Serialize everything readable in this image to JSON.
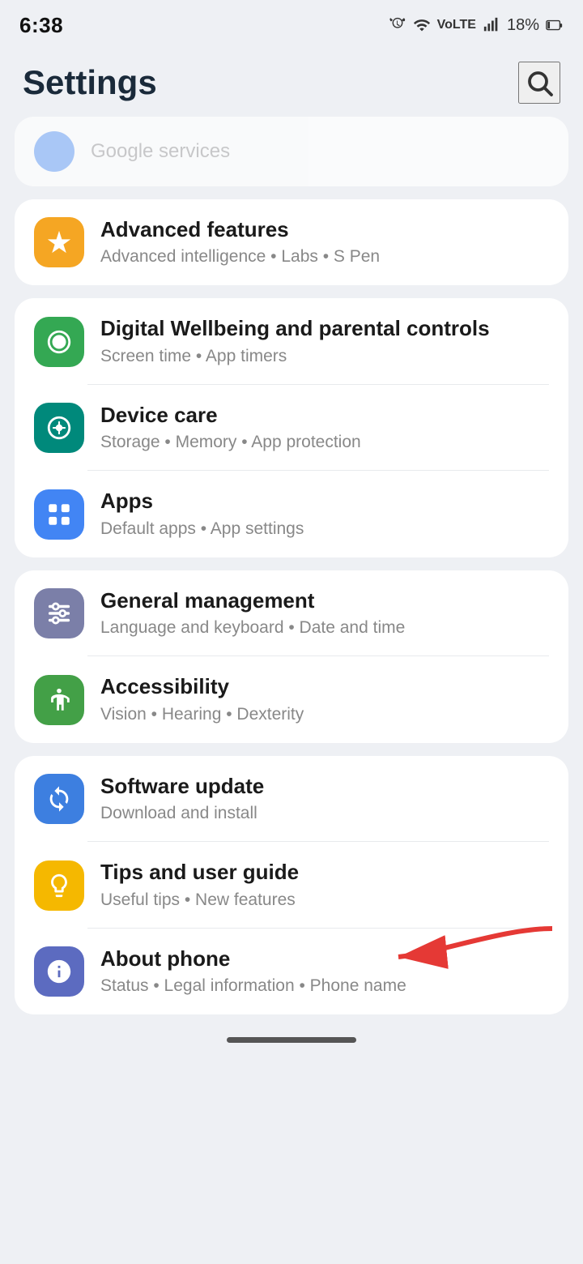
{
  "statusBar": {
    "time": "6:38",
    "battery": "18%",
    "icons": [
      "alarm",
      "wifi",
      "volte",
      "signal",
      "battery"
    ]
  },
  "header": {
    "title": "Settings",
    "searchLabel": "Search"
  },
  "partialItem": {
    "text": "Google services"
  },
  "settingGroups": [
    {
      "id": "advanced",
      "items": [
        {
          "id": "advanced-features",
          "title": "Advanced features",
          "subtitle": "Advanced intelligence • Labs • S Pen",
          "iconBg": "bg-orange",
          "iconType": "star-cog"
        }
      ]
    },
    {
      "id": "wellbeing-apps",
      "items": [
        {
          "id": "digital-wellbeing",
          "title": "Digital Wellbeing and parental controls",
          "subtitle": "Screen time • App timers",
          "iconBg": "bg-green",
          "iconType": "wellbeing"
        },
        {
          "id": "device-care",
          "title": "Device care",
          "subtitle": "Storage • Memory • App protection",
          "iconBg": "bg-teal",
          "iconType": "device-care"
        },
        {
          "id": "apps",
          "title": "Apps",
          "subtitle": "Default apps • App settings",
          "iconBg": "bg-blue",
          "iconType": "apps-grid"
        }
      ]
    },
    {
      "id": "management",
      "items": [
        {
          "id": "general-management",
          "title": "General management",
          "subtitle": "Language and keyboard • Date and time",
          "iconBg": "bg-purple-gray",
          "iconType": "sliders"
        },
        {
          "id": "accessibility",
          "title": "Accessibility",
          "subtitle": "Vision • Hearing • Dexterity",
          "iconBg": "bg-green2",
          "iconType": "accessibility"
        }
      ]
    },
    {
      "id": "support",
      "items": [
        {
          "id": "software-update",
          "title": "Software update",
          "subtitle": "Download and install",
          "iconBg": "bg-blue2",
          "iconType": "update"
        },
        {
          "id": "tips-guide",
          "title": "Tips and user guide",
          "subtitle": "Useful tips • New features",
          "iconBg": "bg-yellow",
          "iconType": "lightbulb"
        },
        {
          "id": "about-phone",
          "title": "About phone",
          "subtitle": "Status • Legal information • Phone name",
          "iconBg": "bg-indigo",
          "iconType": "info"
        }
      ]
    }
  ],
  "arrowAnnotation": {
    "pointsTo": "about-phone"
  }
}
